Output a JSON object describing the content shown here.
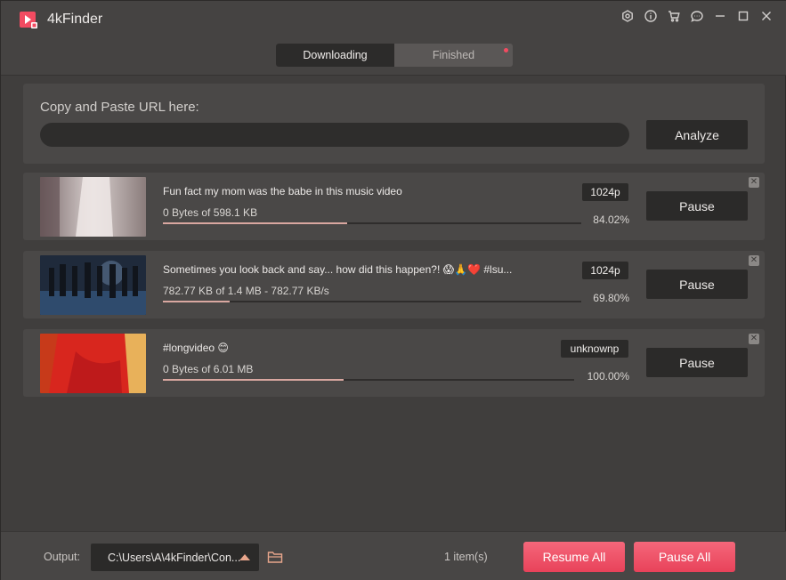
{
  "app": {
    "name": "4kFinder"
  },
  "colors": {
    "accent": "#f24b61",
    "progress": "#d9a7a0",
    "panel": "#4a4847",
    "button": "#2b2a29"
  },
  "window_controls": [
    "settings-icon",
    "info-icon",
    "cart-icon",
    "chat-icon",
    "minimize-icon",
    "maximize-icon",
    "close-icon"
  ],
  "tabs": [
    {
      "label": "Downloading",
      "active": true
    },
    {
      "label": "Finished",
      "active": false,
      "badge": true
    }
  ],
  "url_panel": {
    "label": "Copy and Paste URL here:",
    "value": "",
    "analyze_label": "Analyze"
  },
  "downloads": [
    {
      "title": "Fun fact my mom was the babe in this music video",
      "size": "0 Bytes of 598.1 KB",
      "quality": "1024p",
      "percent": "84.02%",
      "progress": 0.44,
      "button": "Pause"
    },
    {
      "title": "Sometimes you look back and say... how did this happen?! 😱🙏❤️ #lsu...",
      "size": "782.77 KB of 1.4 MB - 782.77 KB/s",
      "quality": "1024p",
      "percent": "69.80%",
      "progress": 0.16,
      "button": "Pause"
    },
    {
      "title": "#longvideo 😊",
      "size": "0 Bytes of 6.01 MB",
      "quality": "unknownp",
      "percent": "100.00%",
      "progress": 0.44,
      "button": "Pause"
    }
  ],
  "bottom": {
    "output_label": "Output:",
    "output_path": "C:\\Users\\A\\4kFinder\\Con...",
    "count": "1 item(s)",
    "resume_all": "Resume All",
    "pause_all": "Pause All"
  }
}
